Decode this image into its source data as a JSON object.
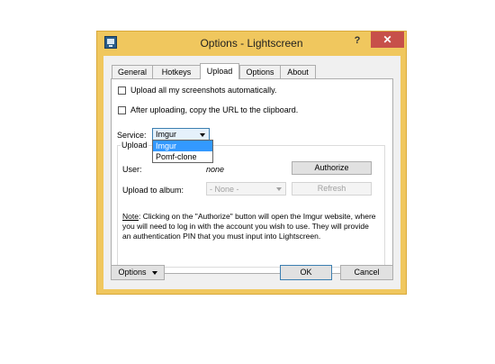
{
  "window": {
    "title": "Options - Lightscreen",
    "help_label": "?",
    "close_label": "✕",
    "icon": "lightscreen-app-icon"
  },
  "tabs": [
    {
      "label": "General",
      "active": false
    },
    {
      "label": "Hotkeys",
      "active": false
    },
    {
      "label": "Upload",
      "active": true
    },
    {
      "label": "Options",
      "active": false
    },
    {
      "label": "About",
      "active": false
    }
  ],
  "upload": {
    "auto_upload_label": "Upload all my screenshots automatically.",
    "auto_upload_checked": false,
    "copy_url_label": "After uploading, copy the URL to the clipboard.",
    "copy_url_checked": false,
    "service_label": "Service:",
    "service_value": "Imgur",
    "service_options": [
      "Imgur",
      "Pomf-clone"
    ],
    "group_title": "Upload",
    "user_label": "User:",
    "user_value": "none",
    "authorize_label": "Authorize",
    "album_label": "Upload to album:",
    "album_value": "- None -",
    "refresh_label": "Refresh",
    "note_prefix": "Note",
    "note_text": ": Clicking on the \"Authorize\" button will open the Imgur website, where you will need to log in with the account you wish to use. They will provide an authentication PIN that you must input into Lightscreen."
  },
  "footer": {
    "options_label": "Options",
    "ok_label": "OK",
    "cancel_label": "Cancel"
  },
  "colors": {
    "window_frame": "#f0c75e",
    "close_button": "#c7504a",
    "selection": "#3399ff",
    "focus_border": "#3c7fb1"
  }
}
